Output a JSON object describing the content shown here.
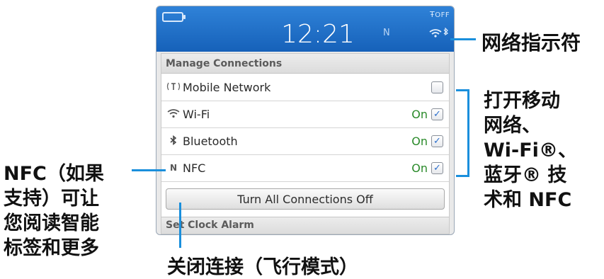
{
  "status_bar": {
    "time": "12:21",
    "nfc_indicator": "N",
    "radio_status": "OFF",
    "icons": [
      "battery-icon",
      "signal-off-icon",
      "nfc-icon",
      "wifi-icon",
      "bluetooth-icon"
    ]
  },
  "menu": {
    "section_title": "Manage Connections",
    "rows": [
      {
        "icon": "mobile-network-icon",
        "glyph": "((ᵀ))",
        "label": "Mobile Network",
        "state": "",
        "checked": false
      },
      {
        "icon": "wifi-icon",
        "glyph": "📶",
        "label": "Wi-Fi",
        "state": "On",
        "checked": true
      },
      {
        "icon": "bluetooth-icon",
        "glyph": "∗",
        "label": "Bluetooth",
        "state": "On",
        "checked": true
      },
      {
        "icon": "nfc-icon",
        "glyph": "Ν",
        "label": "NFC",
        "state": "On",
        "checked": true
      }
    ],
    "turn_off_button": "Turn All Connections Off",
    "next_section": "Set Clock Alarm"
  },
  "callouts": {
    "network_indicator": "网络指示符",
    "toggle_connections": [
      "打开移动",
      "网络、",
      "Wi-Fi®、",
      "蓝牙® 技",
      "术和 NFC"
    ],
    "nfc_support": [
      "NFC（如果",
      "支持）可让",
      "您阅读智能",
      "标签和更多"
    ],
    "airplane_mode": "关闭连接（飞行模式）"
  },
  "colors": {
    "status_bar_top": "#2f82d8",
    "status_bar_bottom": "#1661b9",
    "callout_line": "#1a8fdc",
    "on_text": "#2a8a2a",
    "checkmark": "#2c6fcc"
  }
}
